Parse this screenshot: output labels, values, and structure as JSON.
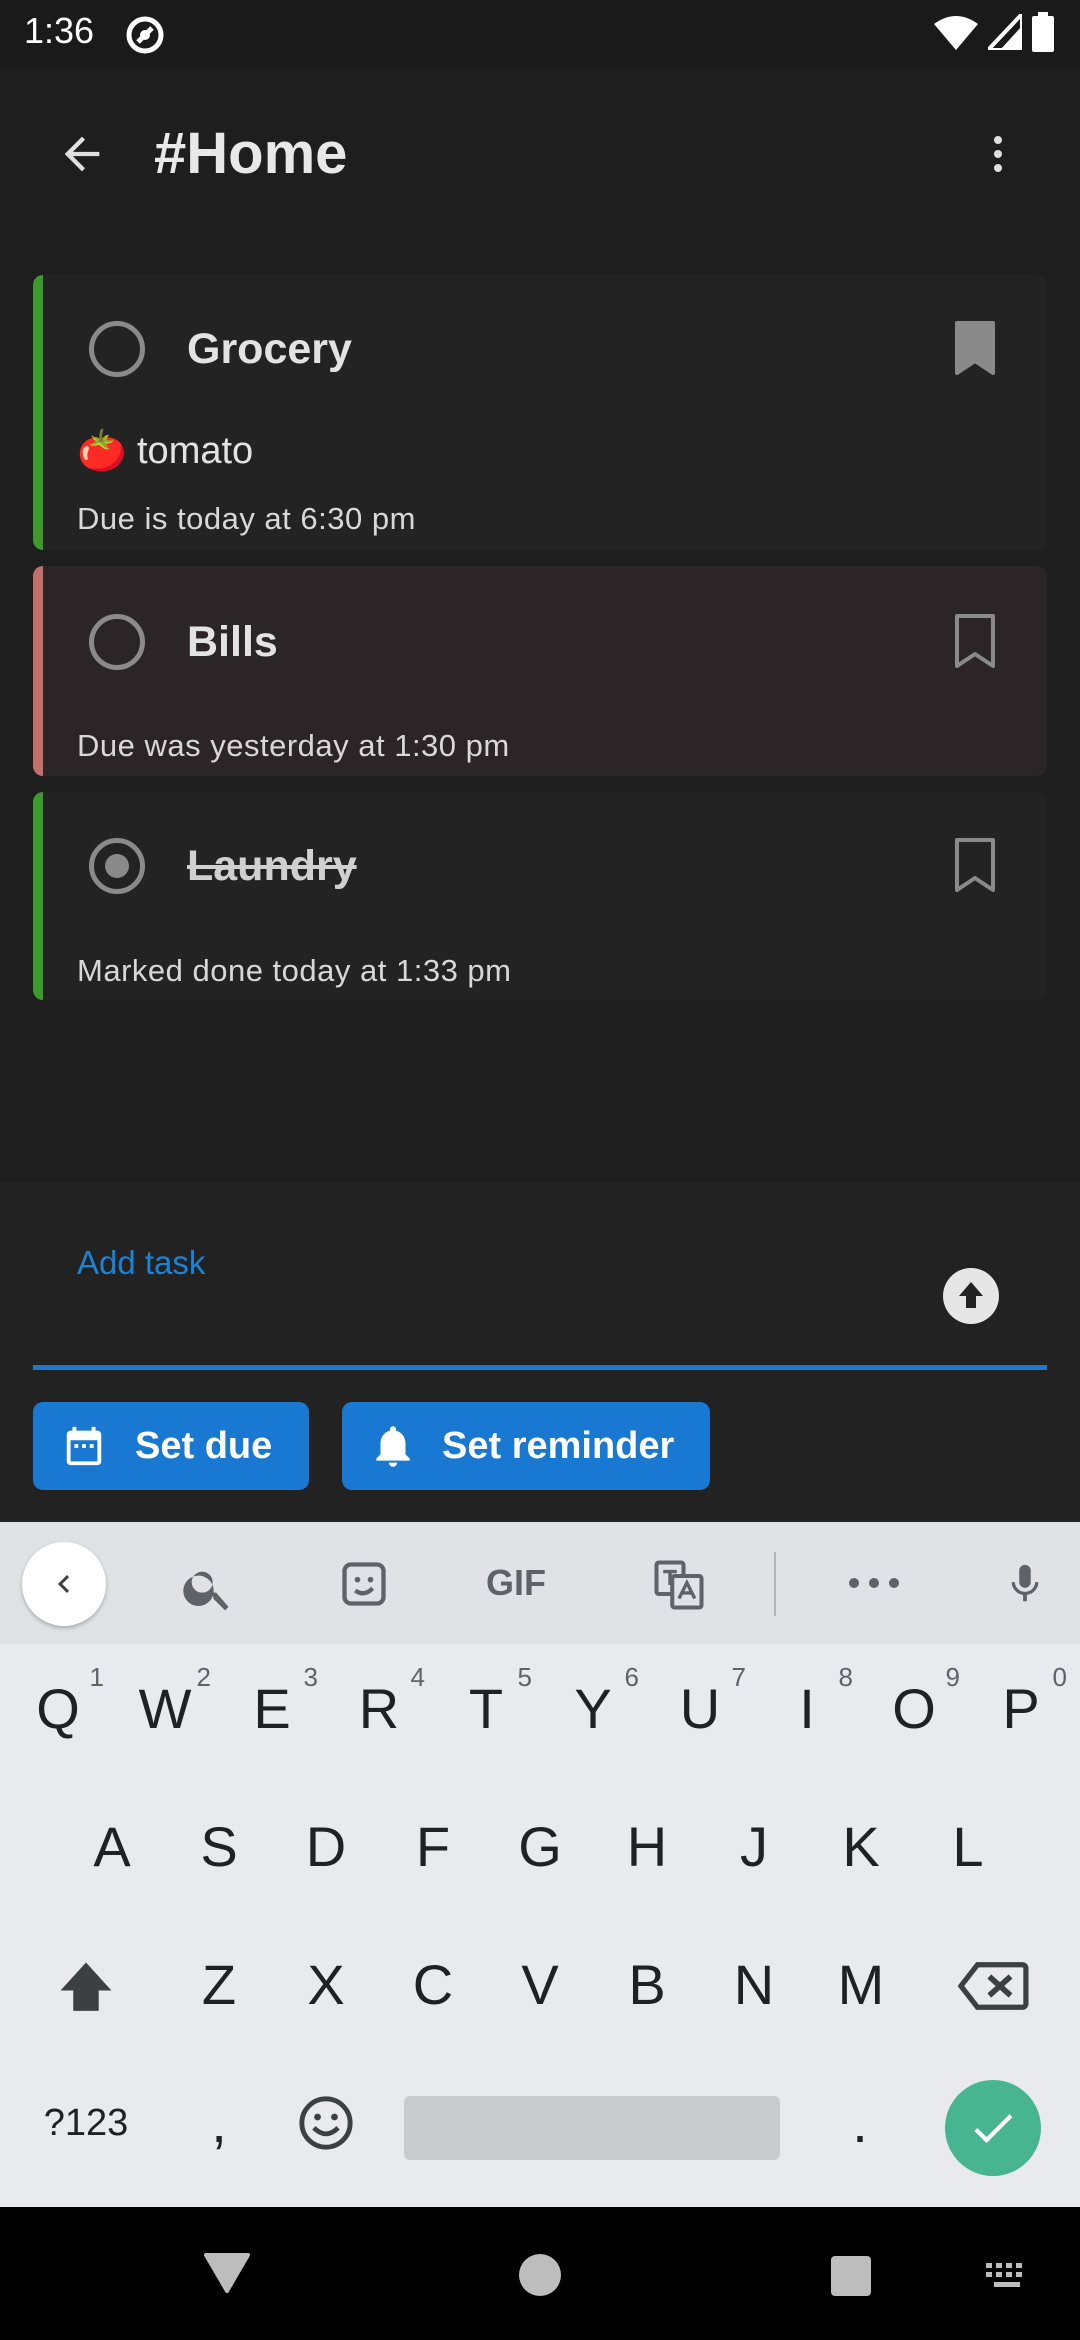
{
  "status_bar": {
    "time": "1:36"
  },
  "header": {
    "title": "#Home"
  },
  "tasks": [
    {
      "name": "Grocery",
      "note_emoji": "🍅",
      "note": "tomato",
      "meta": "Due is today at 6:30 pm",
      "done": false,
      "bookmarked": true,
      "accent": "#3e9a2e"
    },
    {
      "name": "Bills",
      "meta": "Due was yesterday at 1:30 pm",
      "done": false,
      "bookmarked": false,
      "accent": "#c2706c"
    },
    {
      "name": "Laundry",
      "meta": "Marked done today at 1:33 pm",
      "done": true,
      "bookmarked": false,
      "accent": "#3e9a2e"
    }
  ],
  "composer": {
    "placeholder": "Add task",
    "set_due": "Set due",
    "set_reminder": "Set reminder",
    "accent": "#1978d2"
  },
  "keyboard": {
    "toolbar": {
      "gif": "GIF"
    },
    "row1": [
      "Q",
      "W",
      "E",
      "R",
      "T",
      "Y",
      "U",
      "I",
      "O",
      "P"
    ],
    "row1_hints": [
      "1",
      "2",
      "3",
      "4",
      "5",
      "6",
      "7",
      "8",
      "9",
      "0"
    ],
    "row2": [
      "A",
      "S",
      "D",
      "F",
      "G",
      "H",
      "J",
      "K",
      "L"
    ],
    "row3": [
      "Z",
      "X",
      "C",
      "V",
      "B",
      "N",
      "M"
    ],
    "symbols": "?123",
    "comma": ",",
    "period": "."
  }
}
